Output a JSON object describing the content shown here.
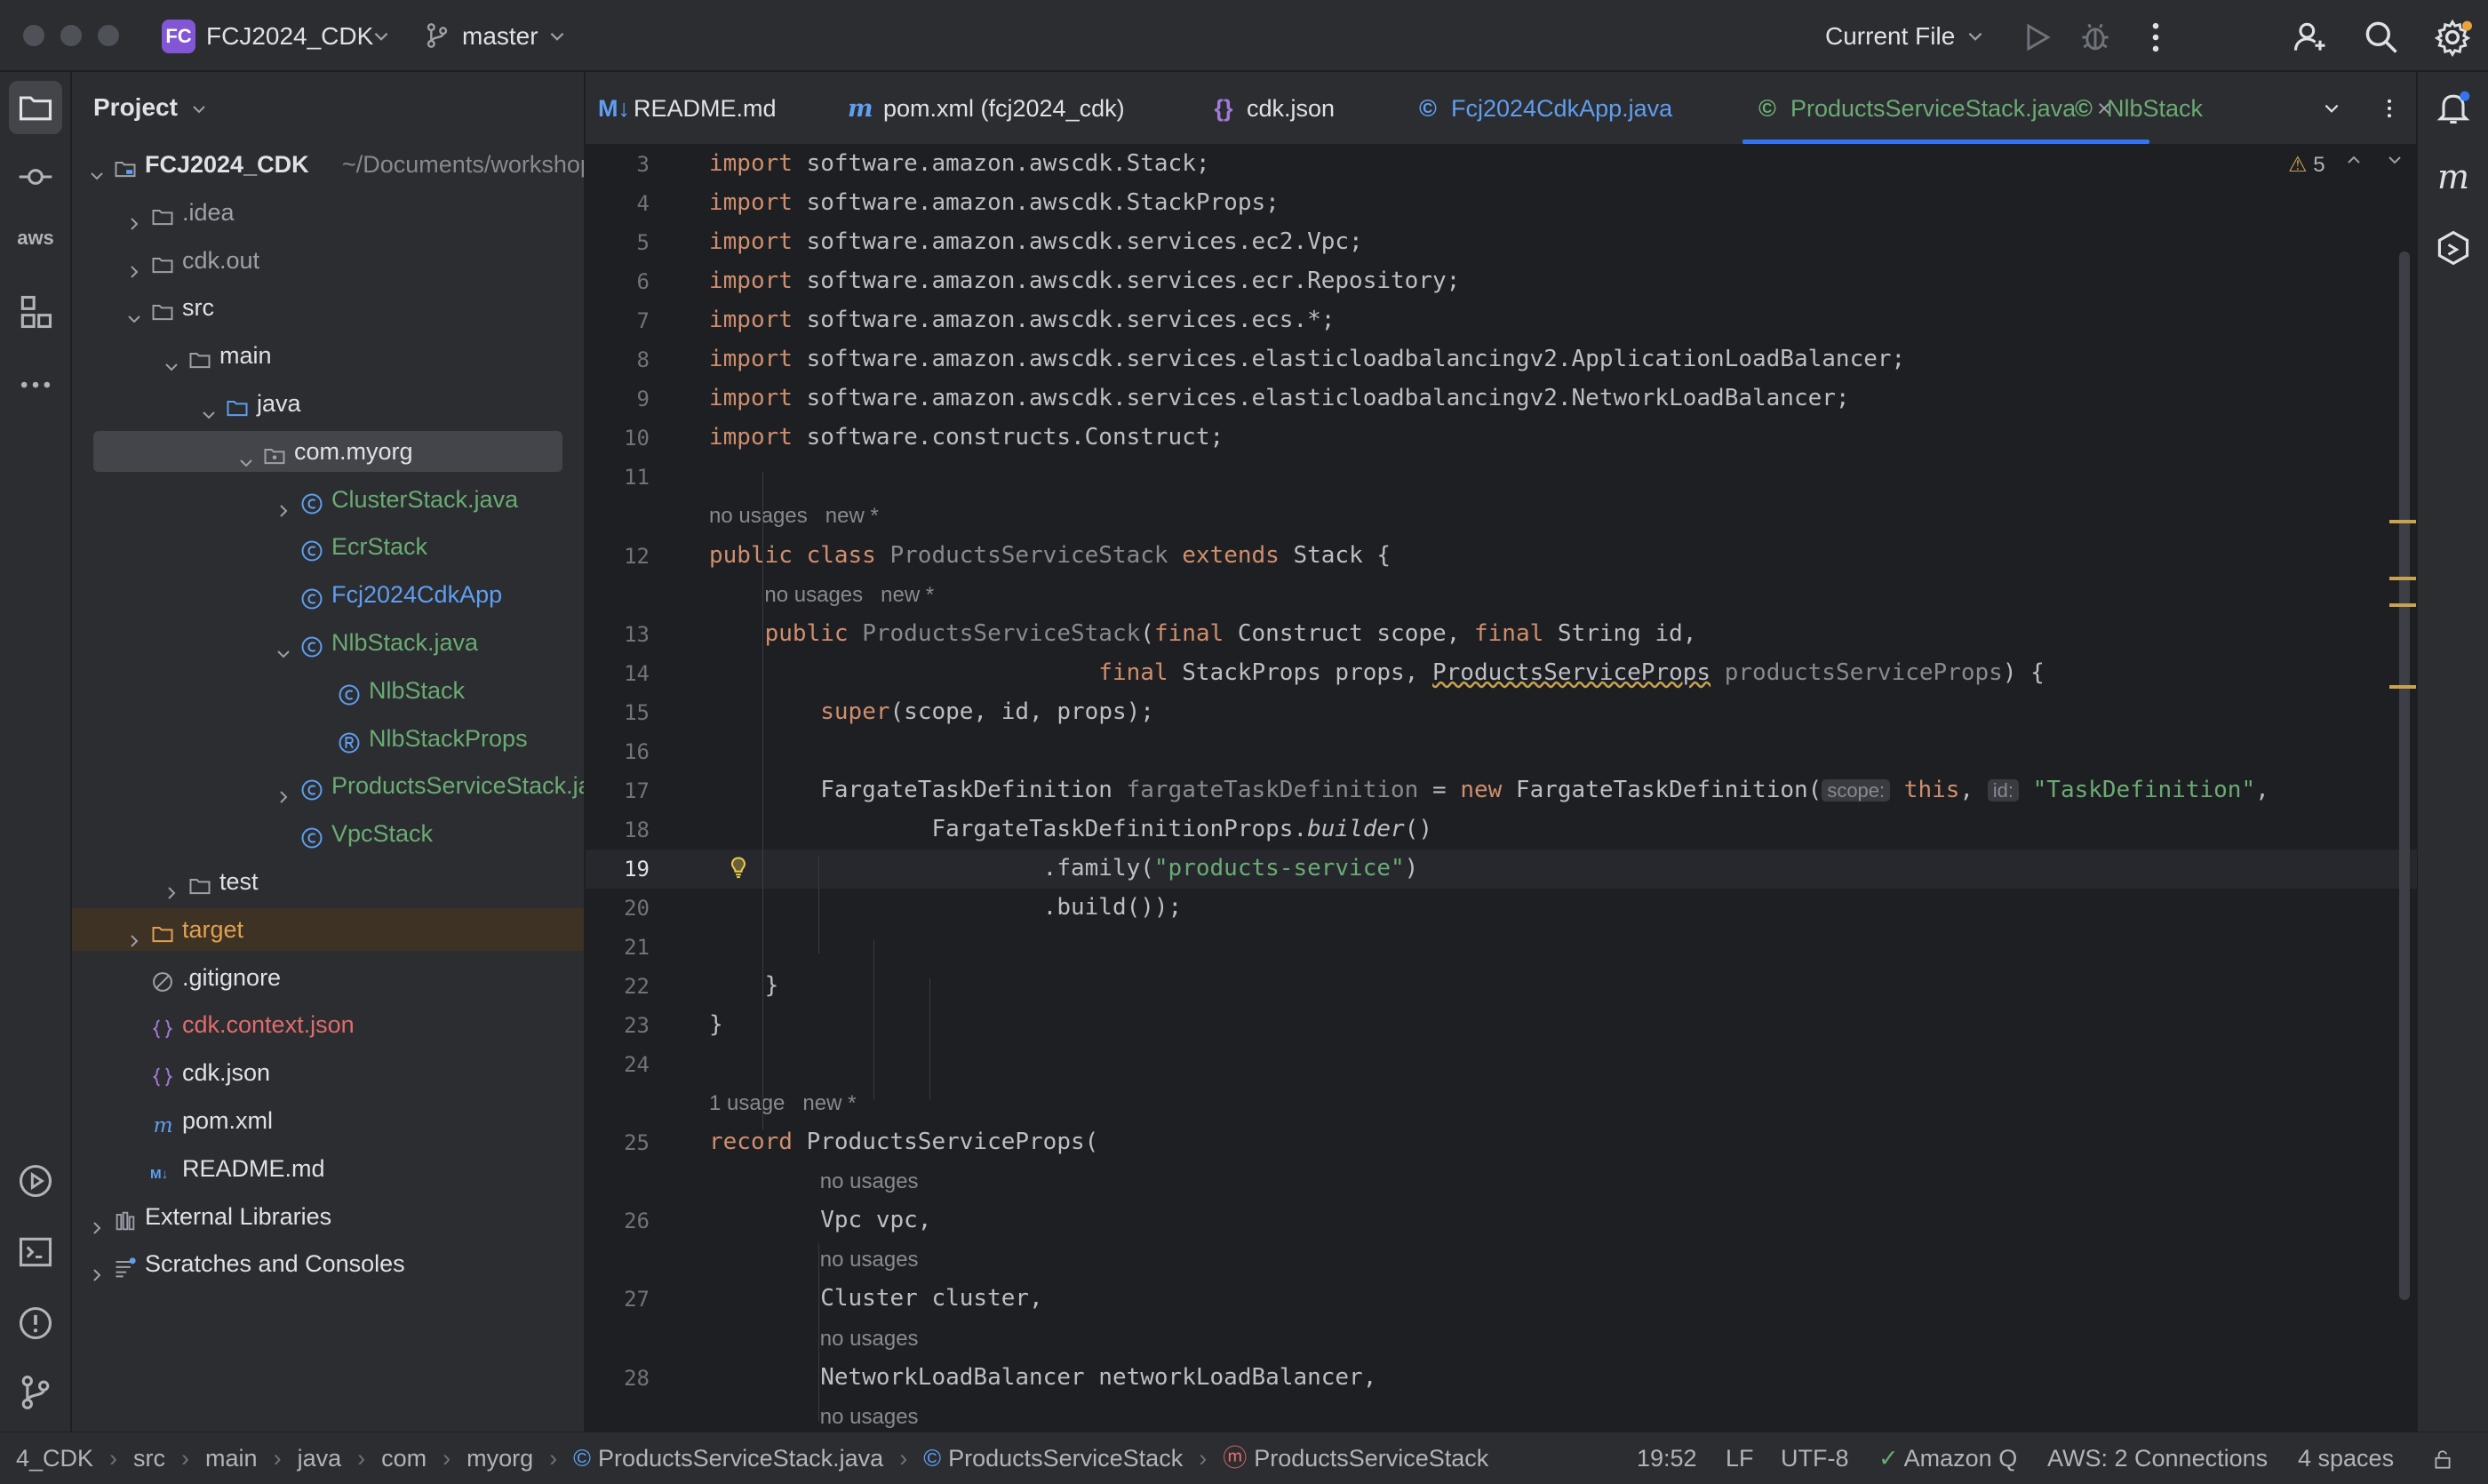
{
  "titlebar": {
    "project_badge": "FC",
    "project_name": "FCJ2024_CDK",
    "branch": "master",
    "run_config": "Current File"
  },
  "project_panel": {
    "title": "Project",
    "tree": [
      {
        "label": "FCJ2024_CDK",
        "suffix": "~/Documents/workshop",
        "kind": "module",
        "indent": 0,
        "chevron": "down",
        "bold": true
      },
      {
        "label": ".idea",
        "kind": "folder",
        "indent": 1,
        "chevron": "right",
        "dim": true
      },
      {
        "label": "cdk.out",
        "kind": "folder",
        "indent": 1,
        "chevron": "right",
        "dim": true
      },
      {
        "label": "src",
        "kind": "folder",
        "indent": 1,
        "chevron": "down"
      },
      {
        "label": "main",
        "kind": "folder",
        "indent": 2,
        "chevron": "down"
      },
      {
        "label": "java",
        "kind": "src-folder",
        "indent": 3,
        "chevron": "down"
      },
      {
        "label": "com.myorg",
        "kind": "package",
        "indent": 4,
        "chevron": "down",
        "selected": true
      },
      {
        "label": "ClusterStack.java",
        "kind": "class",
        "indent": 5,
        "chevron": "right",
        "color": "green"
      },
      {
        "label": "EcrStack",
        "kind": "class",
        "indent": 5,
        "chevron": "",
        "color": "green"
      },
      {
        "label": "Fcj2024CdkApp",
        "kind": "class",
        "indent": 5,
        "chevron": "",
        "color": "blue"
      },
      {
        "label": "NlbStack.java",
        "kind": "class",
        "indent": 5,
        "chevron": "down",
        "color": "green"
      },
      {
        "label": "NlbStack",
        "kind": "class",
        "indent": 6,
        "chevron": "",
        "color": "green"
      },
      {
        "label": "NlbStackProps",
        "kind": "record",
        "indent": 6,
        "chevron": "",
        "color": "green"
      },
      {
        "label": "ProductsServiceStack.java",
        "kind": "class",
        "indent": 5,
        "chevron": "right",
        "color": "green"
      },
      {
        "label": "VpcStack",
        "kind": "class",
        "indent": 5,
        "chevron": "",
        "color": "green"
      },
      {
        "label": "test",
        "kind": "folder",
        "indent": 2,
        "chevron": "right"
      },
      {
        "label": "target",
        "kind": "folder-orange",
        "indent": 1,
        "chevron": "right",
        "color": "orange",
        "highlight": true
      },
      {
        "label": ".gitignore",
        "kind": "ignore",
        "indent": 1,
        "chevron": ""
      },
      {
        "label": "cdk.context.json",
        "kind": "json",
        "indent": 1,
        "chevron": "",
        "color": "red"
      },
      {
        "label": "cdk.json",
        "kind": "json",
        "indent": 1,
        "chevron": ""
      },
      {
        "label": "pom.xml",
        "kind": "maven",
        "indent": 1,
        "chevron": ""
      },
      {
        "label": "README.md",
        "kind": "markdown",
        "indent": 1,
        "chevron": ""
      },
      {
        "label": "External Libraries",
        "kind": "libraries",
        "indent": 0,
        "chevron": "right"
      },
      {
        "label": "Scratches and Consoles",
        "kind": "scratches",
        "indent": 0,
        "chevron": "right"
      }
    ]
  },
  "tabs": [
    {
      "label": "README.md",
      "icon": "M↓",
      "color": "#dfe1e5"
    },
    {
      "label": "pom.xml (fcj2024_cdk)",
      "icon": "m",
      "color": "#dfe1e5"
    },
    {
      "label": "cdk.json",
      "icon": "{}",
      "color": "#dfe1e5"
    },
    {
      "label": "Fcj2024CdkApp.java",
      "icon": "©",
      "color": "#5f9ef0"
    },
    {
      "label": "ProductsServiceStack.java",
      "icon": "©",
      "color": "#6aab73",
      "active": true,
      "closable": true
    },
    {
      "label": "NlbStack",
      "icon": "©",
      "color": "#6aab73"
    }
  ],
  "editor": {
    "warning_count": "5",
    "current_line": "19",
    "lines": [
      {
        "n": "3",
        "html": "<span class='kw'>import</span> software.amazon.awscdk.Stack;"
      },
      {
        "n": "4",
        "html": "<span class='kw'>import</span> software.amazon.awscdk.StackProps;"
      },
      {
        "n": "5",
        "html": "<span class='kw'>import</span> software.amazon.awscdk.services.ec2.Vpc;"
      },
      {
        "n": "6",
        "html": "<span class='kw'>import</span> software.amazon.awscdk.services.ecr.Repository;"
      },
      {
        "n": "7",
        "html": "<span class='kw'>import</span> software.amazon.awscdk.services.ecs.*;"
      },
      {
        "n": "8",
        "html": "<span class='kw'>import</span> software.amazon.awscdk.services.elasticloadbalancingv2.ApplicationLoadBalancer;"
      },
      {
        "n": "9",
        "html": "<span class='kw'>import</span> software.amazon.awscdk.services.elasticloadbalancingv2.NetworkLoadBalancer;"
      },
      {
        "n": "10",
        "html": "<span class='kw'>import</span> software.constructs.Construct;"
      },
      {
        "n": "11",
        "html": ""
      },
      {
        "hint": "no usages   new *",
        "indent": 0
      },
      {
        "n": "12",
        "html": "<span class='kw'>public class</span> <span class='gray'>ProductsServiceStack</span> <span class='kw'>extends</span> Stack {"
      },
      {
        "hint": "no usages   new *",
        "indent": 1
      },
      {
        "n": "13",
        "html": "    <span class='kw'>public</span> <span class='gray'>ProductsServiceStack</span>(<span class='kw'>final</span> Construct scope, <span class='kw'>final</span> String id,"
      },
      {
        "n": "14",
        "html": "                            <span class='kw'>final</span> StackProps props, <span class='warn-u'>ProductsServiceProps</span> <span class='gray'>productsServiceProps</span>) {"
      },
      {
        "n": "15",
        "html": "        <span class='kw'>super</span>(scope, id, props);"
      },
      {
        "n": "16",
        "html": ""
      },
      {
        "n": "17",
        "html": "        FargateTaskDefinition <span class='gray'>fargateTaskDefinition</span> = <span class='kw'>new</span> FargateTaskDefinition(<span class='inlay'>scope:</span> <span class='kw'>this</span>, <span class='inlay'>id:</span> <span class='str'>\"TaskDefinition\"</span>,"
      },
      {
        "n": "18",
        "html": "                FargateTaskDefinitionProps.<i>builder</i>()"
      },
      {
        "n": "19",
        "html": "                        .family(<span class='str'>\"products-service\"</span>)"
      },
      {
        "n": "20",
        "html": "                        .build());"
      },
      {
        "n": "21",
        "html": ""
      },
      {
        "n": "22",
        "html": "    }"
      },
      {
        "n": "23",
        "html": "}"
      },
      {
        "n": "24",
        "html": ""
      },
      {
        "hint": "1 usage   new *",
        "indent": 0
      },
      {
        "n": "25",
        "html": "<span class='kw'>record</span> ProductsServiceProps("
      },
      {
        "hint": "no usages",
        "indent": 2
      },
      {
        "n": "26",
        "html": "        Vpc vpc,"
      },
      {
        "hint": "no usages",
        "indent": 2
      },
      {
        "n": "27",
        "html": "        Cluster cluster,"
      },
      {
        "hint": "no usages",
        "indent": 2
      },
      {
        "n": "28",
        "html": "        NetworkLoadBalancer networkLoadBalancer,"
      },
      {
        "hint": "no usages",
        "indent": 2
      }
    ]
  },
  "statusbar": {
    "breadcrumbs": [
      "4_CDK",
      "src",
      "main",
      "java",
      "com",
      "myorg",
      "ProductsServiceStack.java",
      "ProductsServiceStack",
      "ProductsServiceStack"
    ],
    "position": "19:52",
    "line_sep": "LF",
    "encoding": "UTF-8",
    "amazon_q": "Amazon Q",
    "aws": "AWS: 2 Connections",
    "indent": "4 spaces"
  }
}
